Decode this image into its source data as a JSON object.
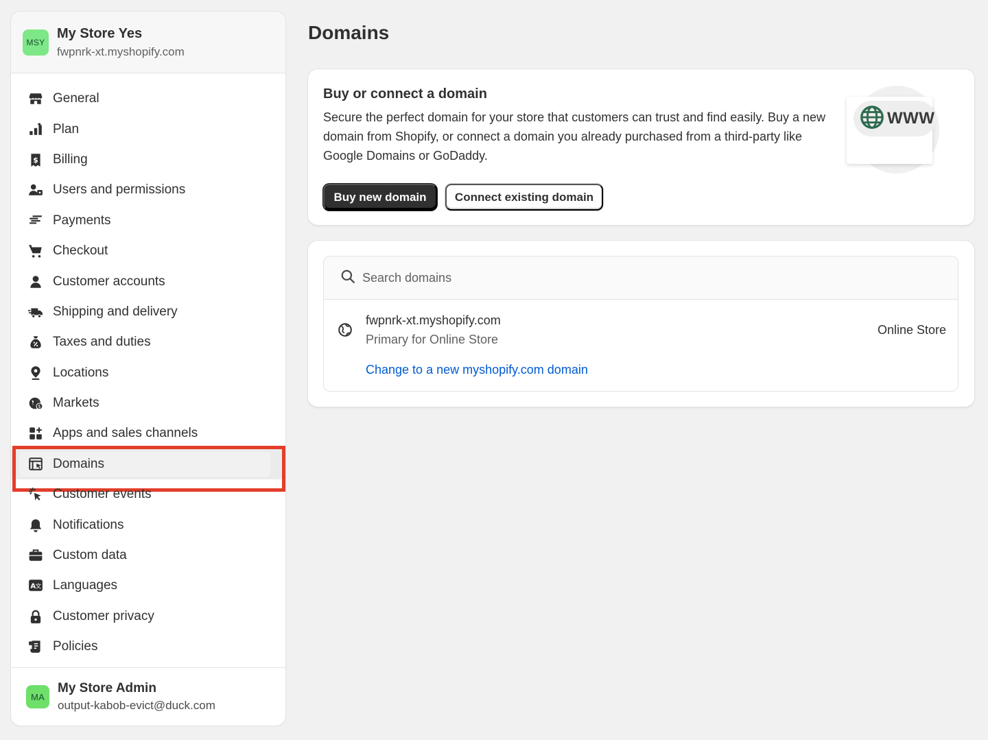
{
  "store": {
    "initials": "MSY",
    "name": "My Store Yes",
    "url": "fwpnrk-xt.myshopify.com"
  },
  "nav": {
    "items": [
      {
        "label": "General",
        "icon": "store-icon"
      },
      {
        "label": "Plan",
        "icon": "plan-icon"
      },
      {
        "label": "Billing",
        "icon": "receipt-dollar-icon"
      },
      {
        "label": "Users and permissions",
        "icon": "users-icon"
      },
      {
        "label": "Payments",
        "icon": "hand-payment-icon"
      },
      {
        "label": "Checkout",
        "icon": "cart-icon"
      },
      {
        "label": "Customer accounts",
        "icon": "person-icon"
      },
      {
        "label": "Shipping and delivery",
        "icon": "delivery-truck-icon"
      },
      {
        "label": "Taxes and duties",
        "icon": "tax-bag-icon"
      },
      {
        "label": "Locations",
        "icon": "location-pin-icon"
      },
      {
        "label": "Markets",
        "icon": "globe-market-icon"
      },
      {
        "label": "Apps and sales channels",
        "icon": "apps-icon"
      },
      {
        "label": "Domains",
        "icon": "domain-icon",
        "active": true
      },
      {
        "label": "Customer events",
        "icon": "cursor-click-icon"
      },
      {
        "label": "Notifications",
        "icon": "bell-icon"
      },
      {
        "label": "Custom data",
        "icon": "briefcase-icon"
      },
      {
        "label": "Languages",
        "icon": "translate-icon"
      },
      {
        "label": "Customer privacy",
        "icon": "lock-icon"
      },
      {
        "label": "Policies",
        "icon": "policy-icon"
      }
    ]
  },
  "admin": {
    "initials": "MA",
    "name": "My Store Admin",
    "email": "output-kabob-evict@duck.com"
  },
  "page": {
    "title": "Domains"
  },
  "connect_card": {
    "title": "Buy or connect a domain",
    "description": "Secure the perfect domain for your store that customers can trust and find easily. Buy a new domain from Shopify, or connect a domain you already purchased from a third-party like Google Domains or GoDaddy.",
    "buy_label": "Buy new domain",
    "connect_label": "Connect existing domain",
    "illustration_text": "WWW"
  },
  "domains_card": {
    "search_placeholder": "Search domains",
    "domain": {
      "name": "fwpnrk-xt.myshopify.com",
      "subtitle": "Primary for Online Store",
      "change_link": "Change to a new myshopify.com domain",
      "channel": "Online Store"
    }
  },
  "colors": {
    "accent_link": "#005bd3",
    "highlight_border": "#e23e2a",
    "primary_button": "#303030",
    "avatar_green": "#7ee787"
  }
}
